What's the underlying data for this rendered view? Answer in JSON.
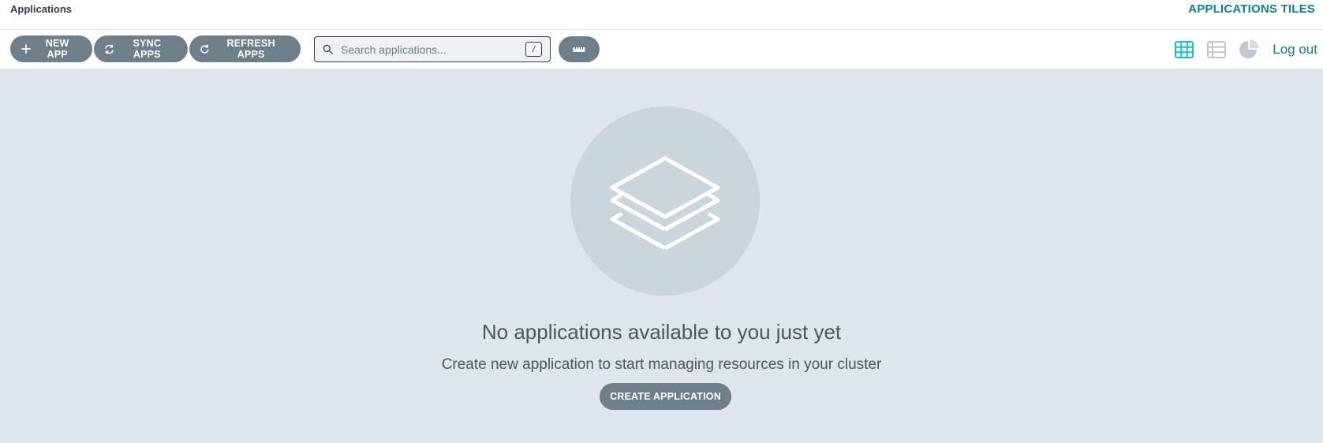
{
  "header": {
    "breadcrumb": "Applications",
    "view_title": "APPLICATIONS TILES"
  },
  "toolbar": {
    "new_app_label": "NEW APP",
    "sync_apps_label": "SYNC APPS",
    "refresh_apps_label": "REFRESH APPS",
    "search": {
      "placeholder": "Search applications...",
      "value": "",
      "shortcut": "/"
    },
    "views": {
      "active": "tiles",
      "items": [
        "tiles",
        "list",
        "summary"
      ]
    },
    "logout_label": "Log out"
  },
  "empty_state": {
    "title": "No applications available to you just yet",
    "subtitle": "Create new application to start managing resources in your cluster",
    "create_label": "CREATE APPLICATION"
  },
  "colors": {
    "accent": "#0d7d9c",
    "active_icon": "#1bbcd4",
    "button": "#6d7f8b",
    "background": "#dee5ec"
  }
}
